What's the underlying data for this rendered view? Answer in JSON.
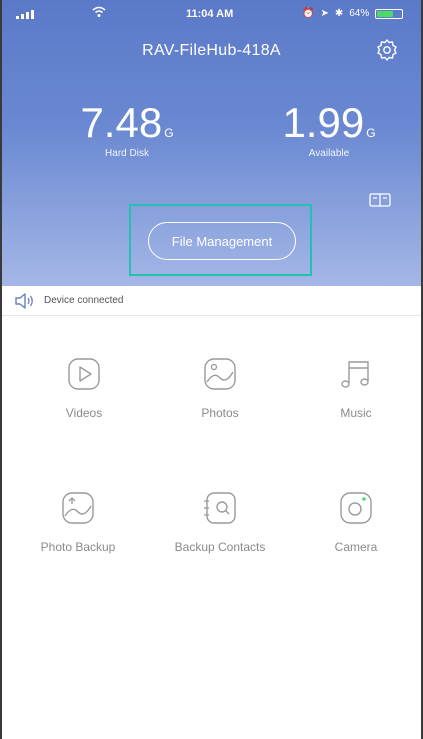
{
  "status_bar": {
    "time": "11:04 AM",
    "battery_text": "64%",
    "battery_level": 0.64,
    "battery_color": "#4cd964"
  },
  "header": {
    "title": "RAV-FileHub-418A",
    "settings_icon": "gear-icon"
  },
  "storage": {
    "hard_disk_value": "7.48",
    "hard_disk_unit": "G",
    "hard_disk_label": "Hard Disk",
    "available_value": "1.99",
    "available_unit": "G",
    "available_label": "Available",
    "storage_icon": "storage-card-icon"
  },
  "file_management": {
    "label": "File Management",
    "highlight_color": "#22c1b0"
  },
  "notice": {
    "icon": "speaker-icon",
    "text": "Device connected"
  },
  "tiles": [
    {
      "label": "Videos",
      "icon": "video-play-icon"
    },
    {
      "label": "Photos",
      "icon": "photo-icon"
    },
    {
      "label": "Music",
      "icon": "music-note-icon"
    },
    {
      "label": "Photo Backup",
      "icon": "photo-backup-icon"
    },
    {
      "label": "Backup Contacts",
      "icon": "contact-card-icon"
    },
    {
      "label": "Camera",
      "icon": "camera-icon"
    }
  ],
  "colors": {
    "hero_top": "#5a79c8",
    "hero_bottom": "#a4b7e6",
    "icon_gray": "#9a9a9a"
  }
}
